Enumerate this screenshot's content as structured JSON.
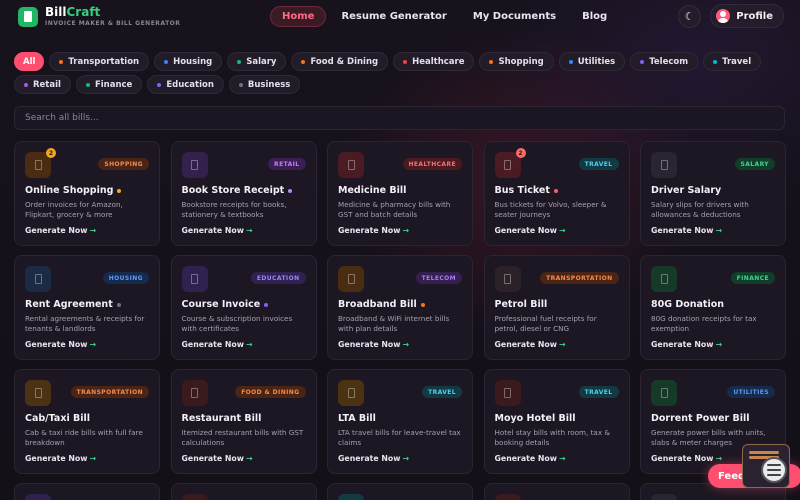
{
  "brand": {
    "part1": "Bill",
    "part2": "Craft",
    "tagline": "INVOICE MAKER & BILL GENERATOR"
  },
  "nav": {
    "links": [
      {
        "label": "Home",
        "active": true
      },
      {
        "label": "Resume Generator",
        "active": false
      },
      {
        "label": "My Documents",
        "active": false
      },
      {
        "label": "Blog",
        "active": false
      }
    ],
    "theme_icon": "☾",
    "profile_label": "Profile"
  },
  "categories": [
    {
      "label": "All",
      "color": "",
      "active": true
    },
    {
      "label": "Transportation",
      "color": "#f97316"
    },
    {
      "label": "Housing",
      "color": "#3b82f6"
    },
    {
      "label": "Salary",
      "color": "#10b981"
    },
    {
      "label": "Food & Dining",
      "color": "#f97316"
    },
    {
      "label": "Healthcare",
      "color": "#ef4444"
    },
    {
      "label": "Shopping",
      "color": "#f97316"
    },
    {
      "label": "Utilities",
      "color": "#3b82f6"
    },
    {
      "label": "Telecom",
      "color": "#8b5cf6"
    },
    {
      "label": "Travel",
      "color": "#06b6d4"
    },
    {
      "label": "Retail",
      "color": "#a855f7"
    },
    {
      "label": "Finance",
      "color": "#10b981"
    },
    {
      "label": "Education",
      "color": "#8b5cf6"
    },
    {
      "label": "Business",
      "color": "#6b7280"
    }
  ],
  "search": {
    "placeholder": "Search all bills..."
  },
  "cta_label": "Generate Now",
  "cta_arrow": "→",
  "cards": [
    {
      "title": "Online Shopping",
      "desc": "Order invoices for Amazon, Flipkart, grocery & more",
      "tag": "SHOPPING",
      "tag_bg": "#4a2414",
      "tag_fg": "#f58b4f",
      "icon_bg": "#4a2c12",
      "badge": "2",
      "badge_color": "#f5a524",
      "title_dot": "#f5a524"
    },
    {
      "title": "Book Store Receipt",
      "desc": "Bookstore receipts for books, stationery & textbooks",
      "tag": "RETAIL",
      "tag_bg": "#3a1f52",
      "tag_fg": "#c47cf5",
      "icon_bg": "#34204d",
      "badge": "",
      "badge_color": "",
      "title_dot": "#a78bfa"
    },
    {
      "title": "Medicine Bill",
      "desc": "Medicine & pharmacy bills with GST and batch details",
      "tag": "HEALTHCARE",
      "tag_bg": "#4a1a1f",
      "tag_fg": "#f2717f",
      "icon_bg": "#4a1b22",
      "badge": "",
      "badge_color": "",
      "title_dot": ""
    },
    {
      "title": "Bus Ticket",
      "desc": "Bus tickets for Volvo, sleeper & seater journeys",
      "tag": "TRAVEL",
      "tag_bg": "#123a45",
      "tag_fg": "#4fd0e8",
      "icon_bg": "#4a1b22",
      "badge": "2",
      "badge_color": "#ff6b6b",
      "title_dot": "#ff5a6a"
    },
    {
      "title": "Driver Salary",
      "desc": "Salary slips for drivers with allowances & deductions",
      "tag": "SALARY",
      "tag_bg": "#123d2b",
      "tag_fg": "#3dd68c",
      "icon_bg": "#2a2530",
      "badge": "",
      "badge_color": "",
      "title_dot": ""
    },
    {
      "title": "Rent Agreement",
      "desc": "Rental agreements & receipts for tenants & landlords",
      "tag": "HOUSING",
      "tag_bg": "#162a4d",
      "tag_fg": "#5b9cf6",
      "icon_bg": "#1b2a45",
      "badge": "",
      "badge_color": "",
      "title_dot": "#6b7280"
    },
    {
      "title": "Course Invoice",
      "desc": "Course & subscription invoices with certificates",
      "tag": "EDUCATION",
      "tag_bg": "#2f2152",
      "tag_fg": "#9d86f5",
      "icon_bg": "#2f2150",
      "badge": "",
      "badge_color": "",
      "title_dot": "#8b5cf6"
    },
    {
      "title": "Broadband Bill",
      "desc": "Broadband & WiFi internet bills with plan details",
      "tag": "TELECOM",
      "tag_bg": "#33204f",
      "tag_fg": "#a77cf5",
      "icon_bg": "#4a2c12",
      "badge": "",
      "badge_color": "",
      "title_dot": "#f97316"
    },
    {
      "title": "Petrol Bill",
      "desc": "Professional fuel receipts for petrol, diesel or CNG",
      "tag": "TRANSPORTATION",
      "tag_bg": "#4a2414",
      "tag_fg": "#f58b4f",
      "icon_bg": "#2a2228",
      "badge": "",
      "badge_color": "",
      "title_dot": ""
    },
    {
      "title": "80G Donation",
      "desc": "80G donation receipts for tax exemption",
      "tag": "FINANCE",
      "tag_bg": "#123d2b",
      "tag_fg": "#3dd68c",
      "icon_bg": "#163a28",
      "badge": "",
      "badge_color": "",
      "title_dot": ""
    },
    {
      "title": "Cab/Taxi Bill",
      "desc": "Cab & taxi ride bills with full fare breakdown",
      "tag": "TRANSPORTATION",
      "tag_bg": "#4a2414",
      "tag_fg": "#f58b4f",
      "icon_bg": "#4a3212",
      "badge": "",
      "badge_color": "",
      "title_dot": ""
    },
    {
      "title": "Restaurant Bill",
      "desc": "Itemized restaurant bills with GST calculations",
      "tag": "FOOD & DINING",
      "tag_bg": "#4a2414",
      "tag_fg": "#f58b4f",
      "icon_bg": "#3a1a1c",
      "badge": "",
      "badge_color": "",
      "title_dot": ""
    },
    {
      "title": "LTA Bill",
      "desc": "LTA travel bills for leave-travel tax claims",
      "tag": "TRAVEL",
      "tag_bg": "#123a45",
      "tag_fg": "#4fd0e8",
      "icon_bg": "#4a3212",
      "badge": "",
      "badge_color": "",
      "title_dot": ""
    },
    {
      "title": "Moyo Hotel Bill",
      "desc": "Hotel stay bills with room, tax & booking details",
      "tag": "TRAVEL",
      "tag_bg": "#123a45",
      "tag_fg": "#4fd0e8",
      "icon_bg": "#3a1a1c",
      "badge": "",
      "badge_color": "",
      "title_dot": ""
    },
    {
      "title": "Dorrent Power Bill",
      "desc": "Generate power bills with units, slabs & meter charges",
      "tag": "UTILITIES",
      "tag_bg": "#162a4d",
      "tag_fg": "#5b9cf6",
      "icon_bg": "#163a28",
      "badge": "",
      "badge_color": "",
      "title_dot": ""
    }
  ],
  "stub_icon_colors": [
    "#2f2150",
    "#3a1a1c",
    "#123a45",
    "#3a1a1c",
    "#2a2530"
  ],
  "feedback_label": "Feedback"
}
